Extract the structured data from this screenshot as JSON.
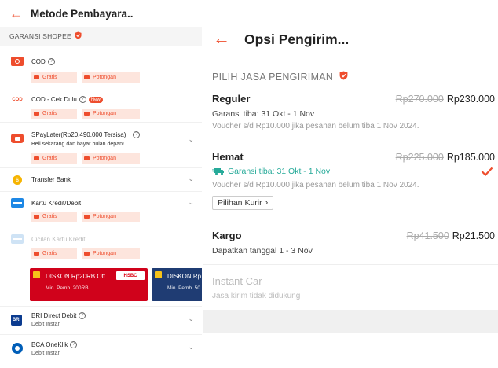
{
  "left": {
    "title": "Metode Pembayara..",
    "guarantee": "GARANSI SHOPEE",
    "payments": [
      {
        "name": "COD",
        "tags": [
          "Gratis",
          "Potongan"
        ]
      },
      {
        "name": "COD - Cek Dulu",
        "badge": "New",
        "tags": [
          "Gratis",
          "Potongan"
        ]
      },
      {
        "name": "SPayLater(Rp20.490.000 Tersisa)",
        "sub": "Beli sekarang dan bayar bulan depan!",
        "tags": [
          "Gratis",
          "Potongan"
        ]
      },
      {
        "name": "Transfer Bank"
      },
      {
        "name": "Kartu Kredit/Debit",
        "tags": [
          "Gratis",
          "Potongan"
        ]
      },
      {
        "name": "Cicilan Kartu Kredit",
        "tags": [
          "Gratis",
          "Potongan"
        ]
      },
      {
        "name": "BRI Direct Debit",
        "sub": "Debit Instan"
      },
      {
        "name": "BCA OneKlik",
        "sub": "Debit Instan"
      }
    ],
    "promos": [
      {
        "title": "DISKON Rp20RB Off",
        "sub": "Min. Pemb. 200RB",
        "logo": "HSBC",
        "color": "#d0021b"
      },
      {
        "title": "DISKON Rp",
        "sub": "Min. Pemb. 50",
        "color": "#1f3c73"
      }
    ]
  },
  "right": {
    "title": "Opsi Pengirim...",
    "section": "PILIH JASA PENGIRIMAN",
    "options": [
      {
        "name": "Reguler",
        "old_price": "Rp270.000",
        "price": "Rp230.000",
        "line": "Garansi tiba: 31 Okt - 1 Nov",
        "note": "Voucher s/d  Rp10.000 jika pesanan belum tiba 1 Nov 2024."
      },
      {
        "name": "Hemat",
        "old_price": "Rp225.000",
        "price": "Rp185.000",
        "line": "Garansi tiba: 31 Okt - 1 Nov",
        "note": "Voucher s/d  Rp10.000 jika pesanan belum tiba 1 Nov 2024.",
        "button": "Pilihan Kurir",
        "selected": true
      },
      {
        "name": "Kargo",
        "old_price": "Rp41.500",
        "price": "Rp21.500",
        "line": "Dapatkan tanggal 1 - 3 Nov"
      },
      {
        "name": "Instant Car",
        "note": "Jasa kirim tidak didukung",
        "disabled": true
      }
    ]
  },
  "colors": {
    "accent": "#ee4d2d",
    "green": "#26aa99"
  }
}
